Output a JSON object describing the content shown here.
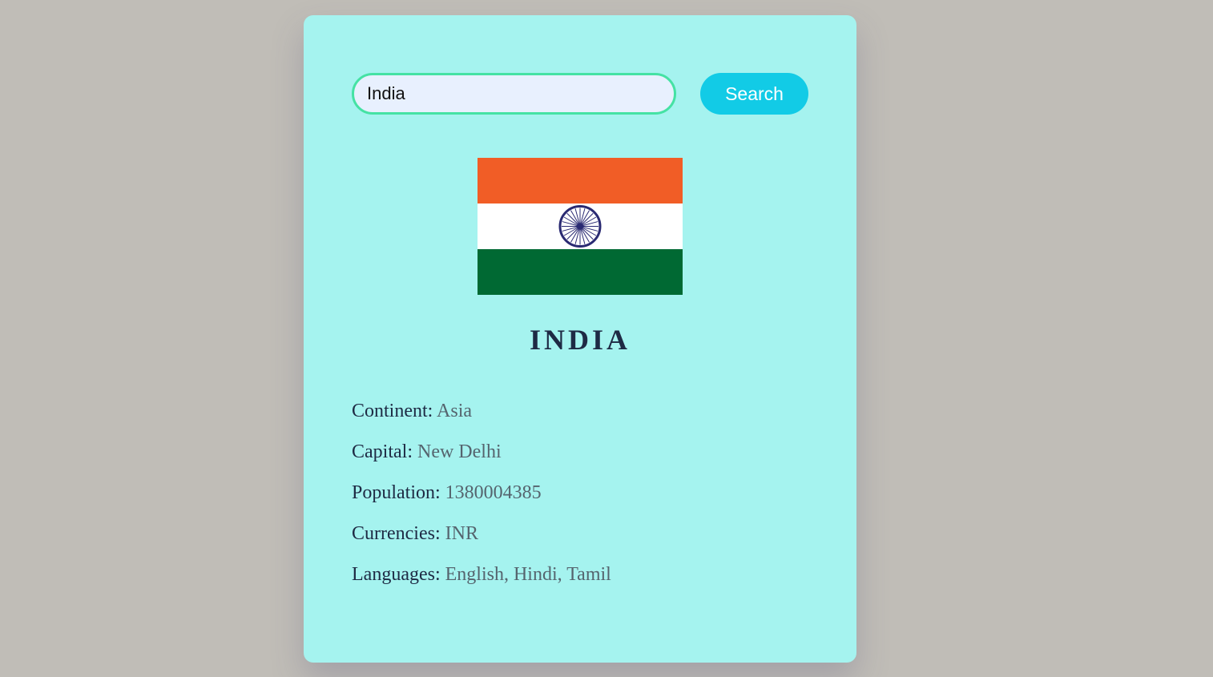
{
  "search": {
    "value": "India",
    "button_label": "Search"
  },
  "country": {
    "name": "INDIA",
    "flag_colors": {
      "saffron": "#f15d26",
      "white": "#ffffff",
      "green": "#006933",
      "chakra": "#2a2a72"
    }
  },
  "details": [
    {
      "label": "Continent:",
      "value": "Asia"
    },
    {
      "label": "Capital:",
      "value": "New Delhi"
    },
    {
      "label": "Population:",
      "value": "1380004385"
    },
    {
      "label": "Currencies:",
      "value": "INR"
    },
    {
      "label": "Languages:",
      "value": "English, Hindi, Tamil"
    }
  ],
  "colors": {
    "background": "#c0bdb7",
    "card": "#a5f3ef",
    "accent": "#12cbe6",
    "input_border": "#45e2a4"
  }
}
